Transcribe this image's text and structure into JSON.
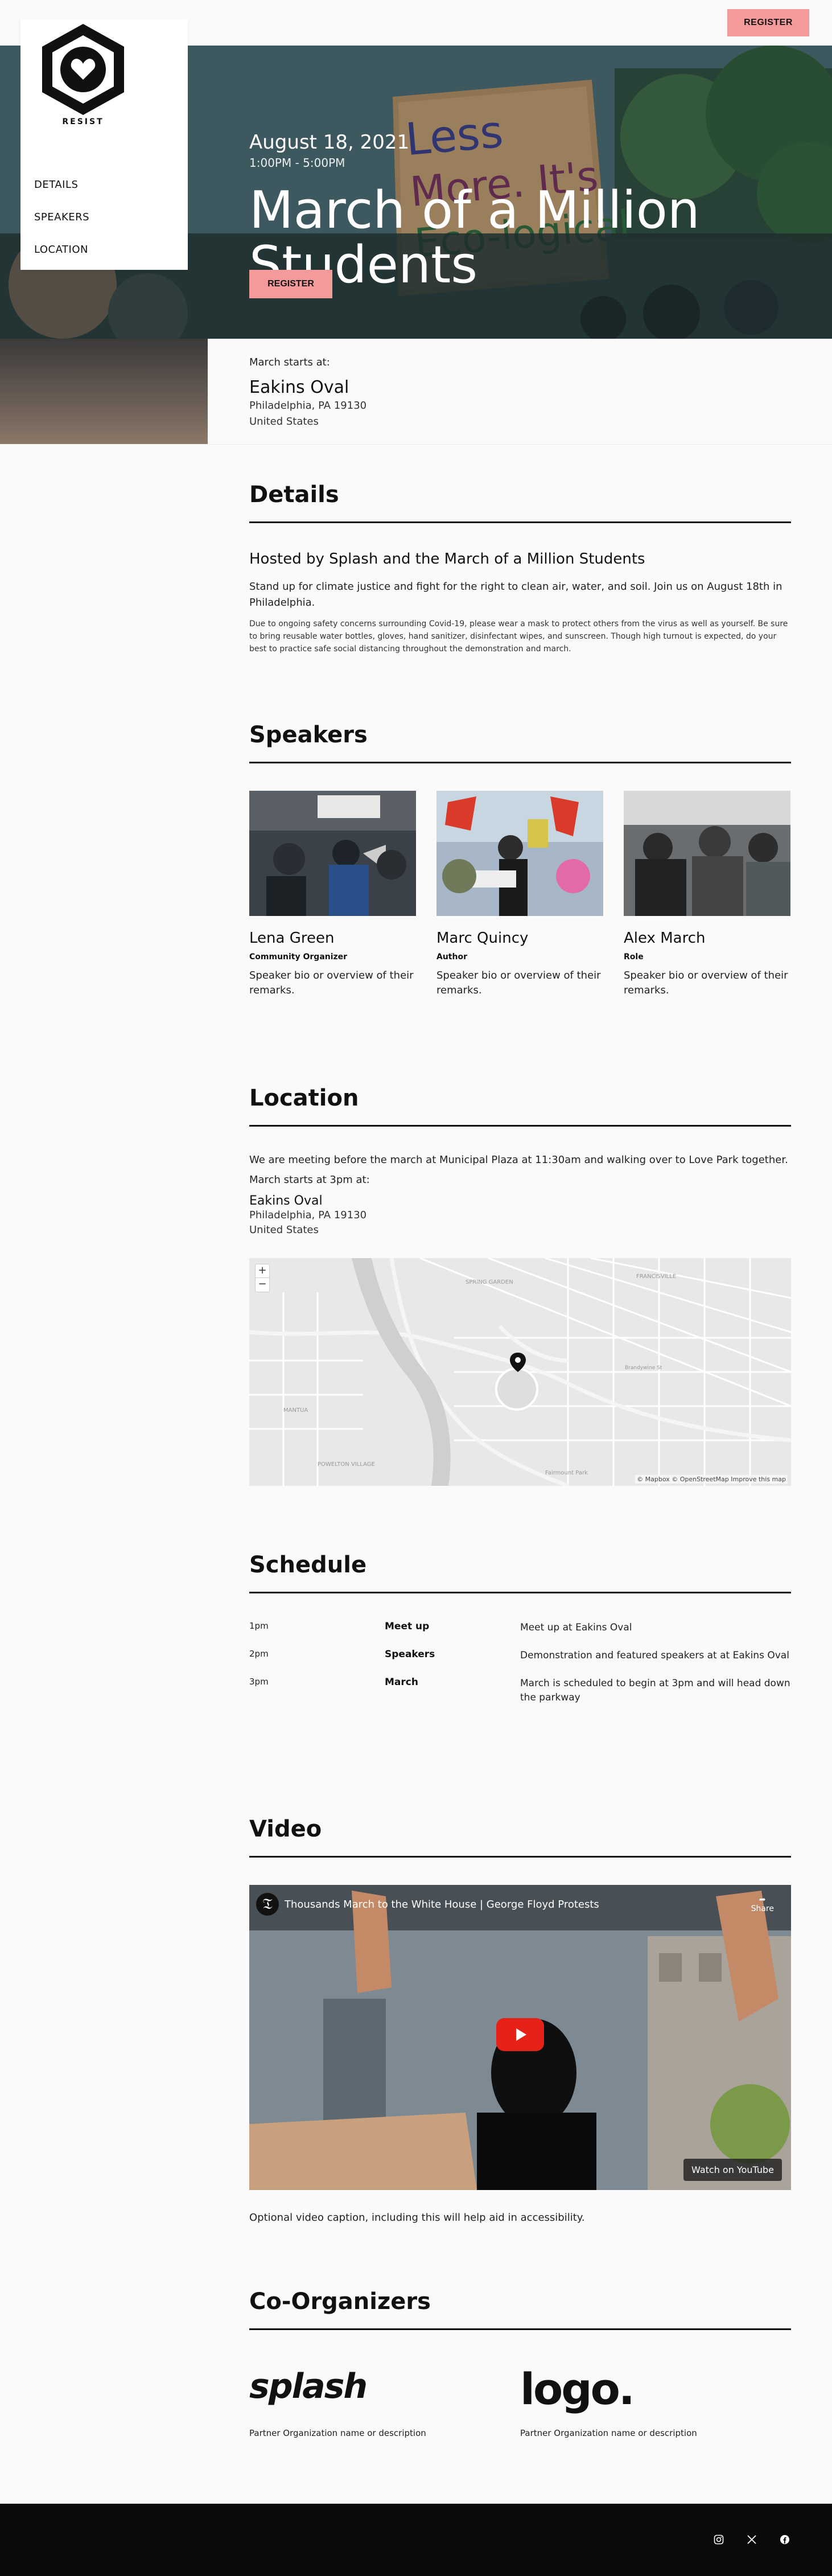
{
  "header": {
    "register_label": "REGISTER"
  },
  "brand": {
    "logo_text": "RESIST"
  },
  "nav": {
    "items": [
      "DETAILS",
      "SPEAKERS",
      "LOCATION"
    ]
  },
  "hero": {
    "date": "August 18, 2021",
    "time": "1:00PM - 5:00PM",
    "title": "March of a Million Students",
    "register_label": "REGISTER",
    "sign_text": "Less More. It's Eco-logical"
  },
  "venue": {
    "label": "March starts at:",
    "name": "Eakins Oval",
    "addr1": "Philadelphia, PA 19130",
    "addr2": "United States"
  },
  "details": {
    "title": "Details",
    "subtitle": "Hosted by Splash and the March of a Million Students",
    "p1": "Stand up for climate justice and fight for the right to clean air, water, and soil. Join us on August 18th in Philadelphia.",
    "p2": "Due to ongoing safety concerns surrounding Covid-19, please wear a mask to protect others from the virus as well as yourself. Be sure to bring reusable water bottles, gloves, hand sanitizer, disinfectant wipes, and sunscreen. Though high turnout is expected, do your best to practice safe social distancing throughout the demonstration and march."
  },
  "speakers": {
    "title": "Speakers",
    "items": [
      {
        "name": "Lena Green",
        "role": "Community Organizer",
        "bio": "Speaker bio or overview of their remarks."
      },
      {
        "name": "Marc Quincy",
        "role": "Author",
        "bio": "Speaker bio or overview of their remarks."
      },
      {
        "name": "Alex March",
        "role": "Role",
        "bio": "Speaker bio or overview of their remarks."
      }
    ]
  },
  "location": {
    "title": "Location",
    "desc": "We are meeting before the march at Municipal Plaza at 11:30am and walking over to Love Park together.",
    "start": "March starts at 3pm at:",
    "name": "Eakins Oval",
    "addr1": "Philadelphia, PA 19130",
    "addr2": "United States",
    "map_attribution": "© Mapbox © OpenStreetMap Improve this map",
    "zoom_in": "+",
    "zoom_out": "−"
  },
  "schedule": {
    "title": "Schedule",
    "rows": [
      {
        "time": "1pm",
        "event": "Meet up",
        "desc": "Meet up at Eakins Oval"
      },
      {
        "time": "2pm",
        "event": "Speakers",
        "desc": "Demonstration and featured speakers at at Eakins Oval"
      },
      {
        "time": "3pm",
        "event": "March",
        "desc": "March is scheduled to begin at 3pm and will head down the parkway"
      }
    ]
  },
  "video": {
    "title": "Video",
    "video_title": "Thousands March to the White House | George Floyd Protests",
    "share_label": "Share",
    "watch_label": "Watch on YouTube",
    "caption": "Optional video caption, including this will help aid in accessibility."
  },
  "coorganizers": {
    "title": "Co-Organizers",
    "items": [
      {
        "logo": "splash",
        "desc": "Partner Organization name or description"
      },
      {
        "logo": "logo.",
        "desc": "Partner Organization name or description"
      }
    ]
  },
  "colors": {
    "accent": "#f59a9a",
    "footer": "#0a0a0a"
  }
}
